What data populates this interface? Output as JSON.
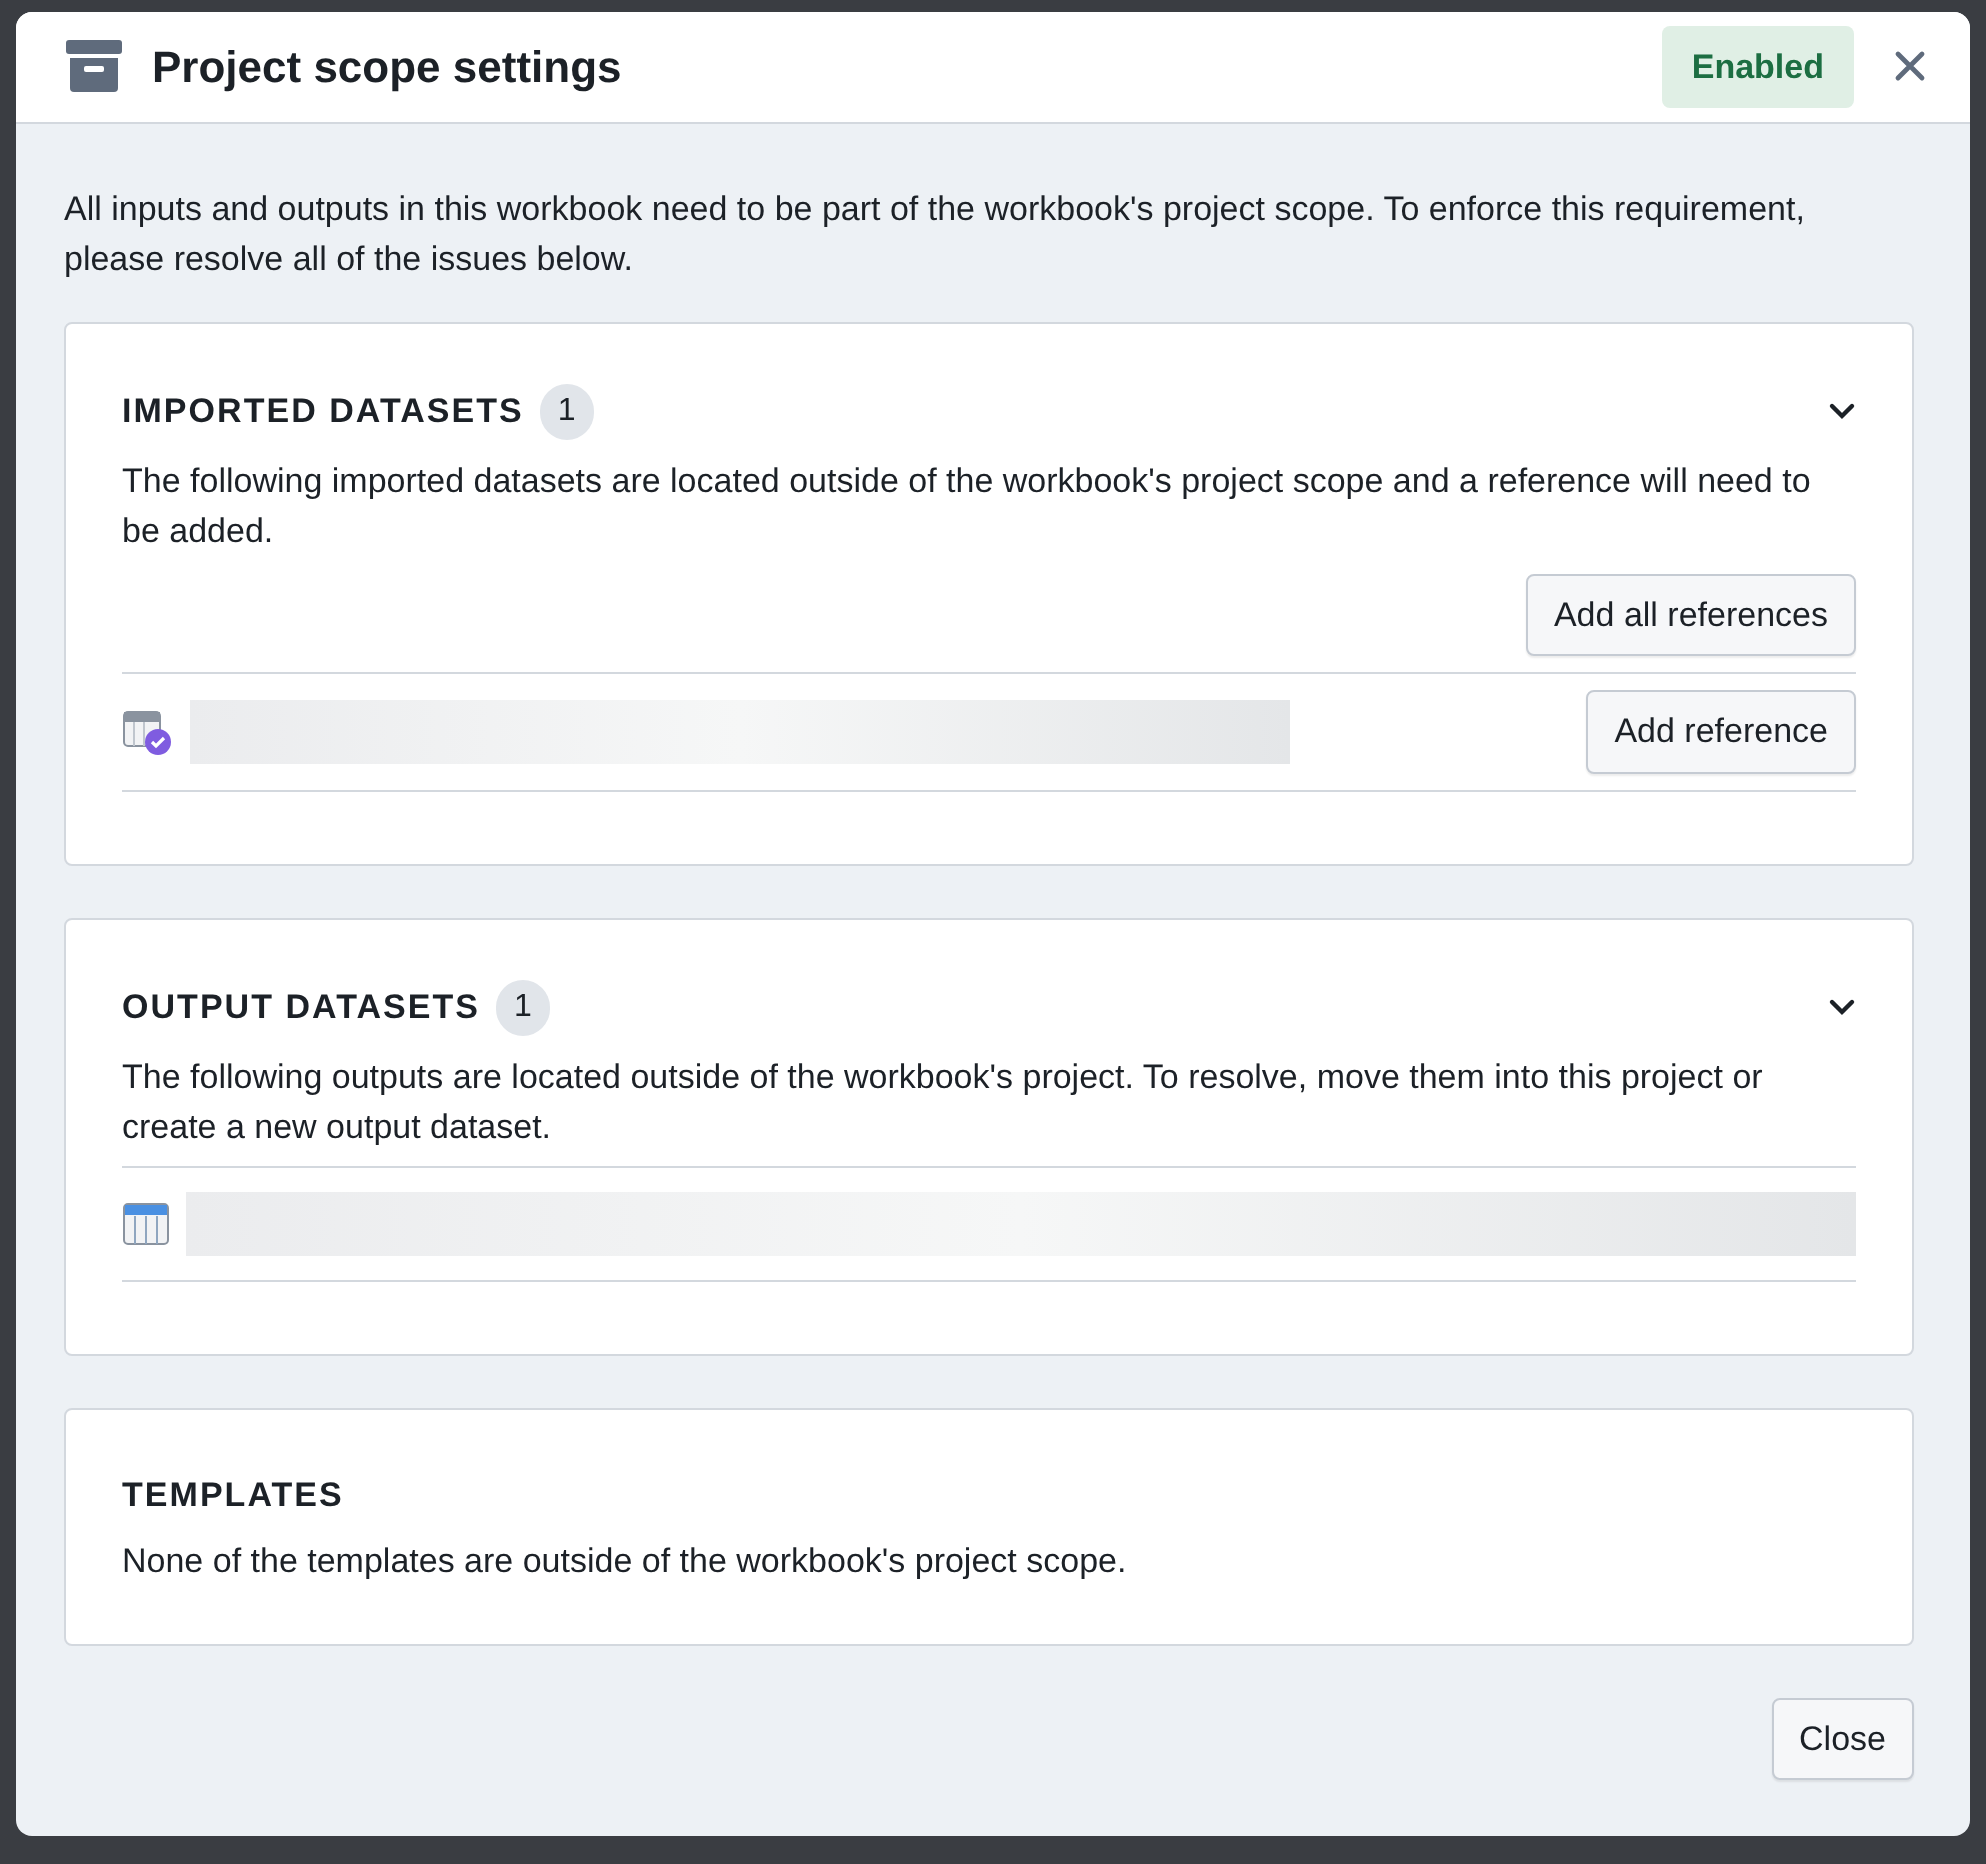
{
  "dialog": {
    "title": "Project scope settings",
    "status_tag": "Enabled",
    "intro": "All inputs and outputs in this workbook need to be part of the workbook's project scope. To enforce this requirement, please resolve all of the issues below.",
    "sections": [
      {
        "kind": "issues",
        "title": "IMPORTED DATASETS",
        "count": "1",
        "expanded": true,
        "description": "The following imported datasets are located outside of the workbook's project scope and a reference will need to be added.",
        "bulk_button": "Add all references",
        "rows": [
          {
            "kind": "imported",
            "button": "Add reference"
          }
        ]
      },
      {
        "kind": "issues",
        "title": "OUTPUT DATASETS",
        "count": "1",
        "expanded": true,
        "description": "The following outputs are located outside of the workbook's project. To resolve, move them into this project or create a new output dataset.",
        "rows": [
          {
            "kind": "output"
          }
        ]
      },
      {
        "kind": "info",
        "title": "TEMPLATES",
        "description": "None of the templates are outside of the workbook's project scope."
      }
    ],
    "footer_button": "Close"
  }
}
